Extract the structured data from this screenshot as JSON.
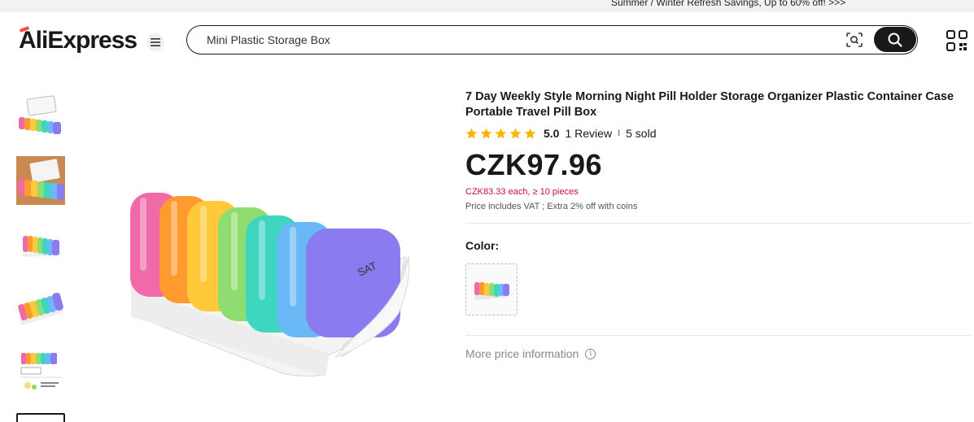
{
  "promo": {
    "text": "Summer / Winter Refresh Savings, Up to 60% off! >>>"
  },
  "header": {
    "logo_text": "AliExpress",
    "menu_icon": "hamburger-icon",
    "search": {
      "value": "Mini Plastic Storage Box",
      "placeholder": "Mini Plastic Storage Box"
    },
    "image_search_icon": "camera-scan-icon",
    "search_button_icon": "search-icon",
    "qr_icon": "qr-code-icon"
  },
  "gallery": {
    "thumbnails": [
      {
        "alt": "pill box thumbnail 1"
      },
      {
        "alt": "pill box thumbnail 2"
      },
      {
        "alt": "pill box thumbnail 3"
      },
      {
        "alt": "pill box thumbnail 4"
      },
      {
        "alt": "pill box thumbnail 5"
      },
      {
        "alt": "pill box thumbnail 6"
      }
    ],
    "main_image_label": "SAT"
  },
  "product": {
    "title": "7 Day Weekly Style Morning Night Pill Holder Storage Organizer Plastic Container Case Portable Travel Pill Box",
    "rating": {
      "stars": 5,
      "score": "5.0",
      "reviews": "1 Review",
      "separator": "I",
      "sold": "5 sold"
    },
    "price": "CZK97.96",
    "bulk_price": "CZK83.33 each, ≥ 10 pieces",
    "vat_note": "Price includes VAT ; Extra 2% off with coins",
    "color_label": "Color:",
    "more_price_info": "More price information",
    "info_icon": "info-circle-icon"
  },
  "colors": {
    "star": "#f7b500",
    "bulk_price": "#c8102e",
    "pink": "#f06aa8",
    "orange": "#ff9a2e",
    "yellow": "#ffc93a",
    "green": "#8fdc70",
    "teal": "#3fd6c0",
    "blue": "#6ab8f5",
    "purple": "#8a7cf0"
  }
}
